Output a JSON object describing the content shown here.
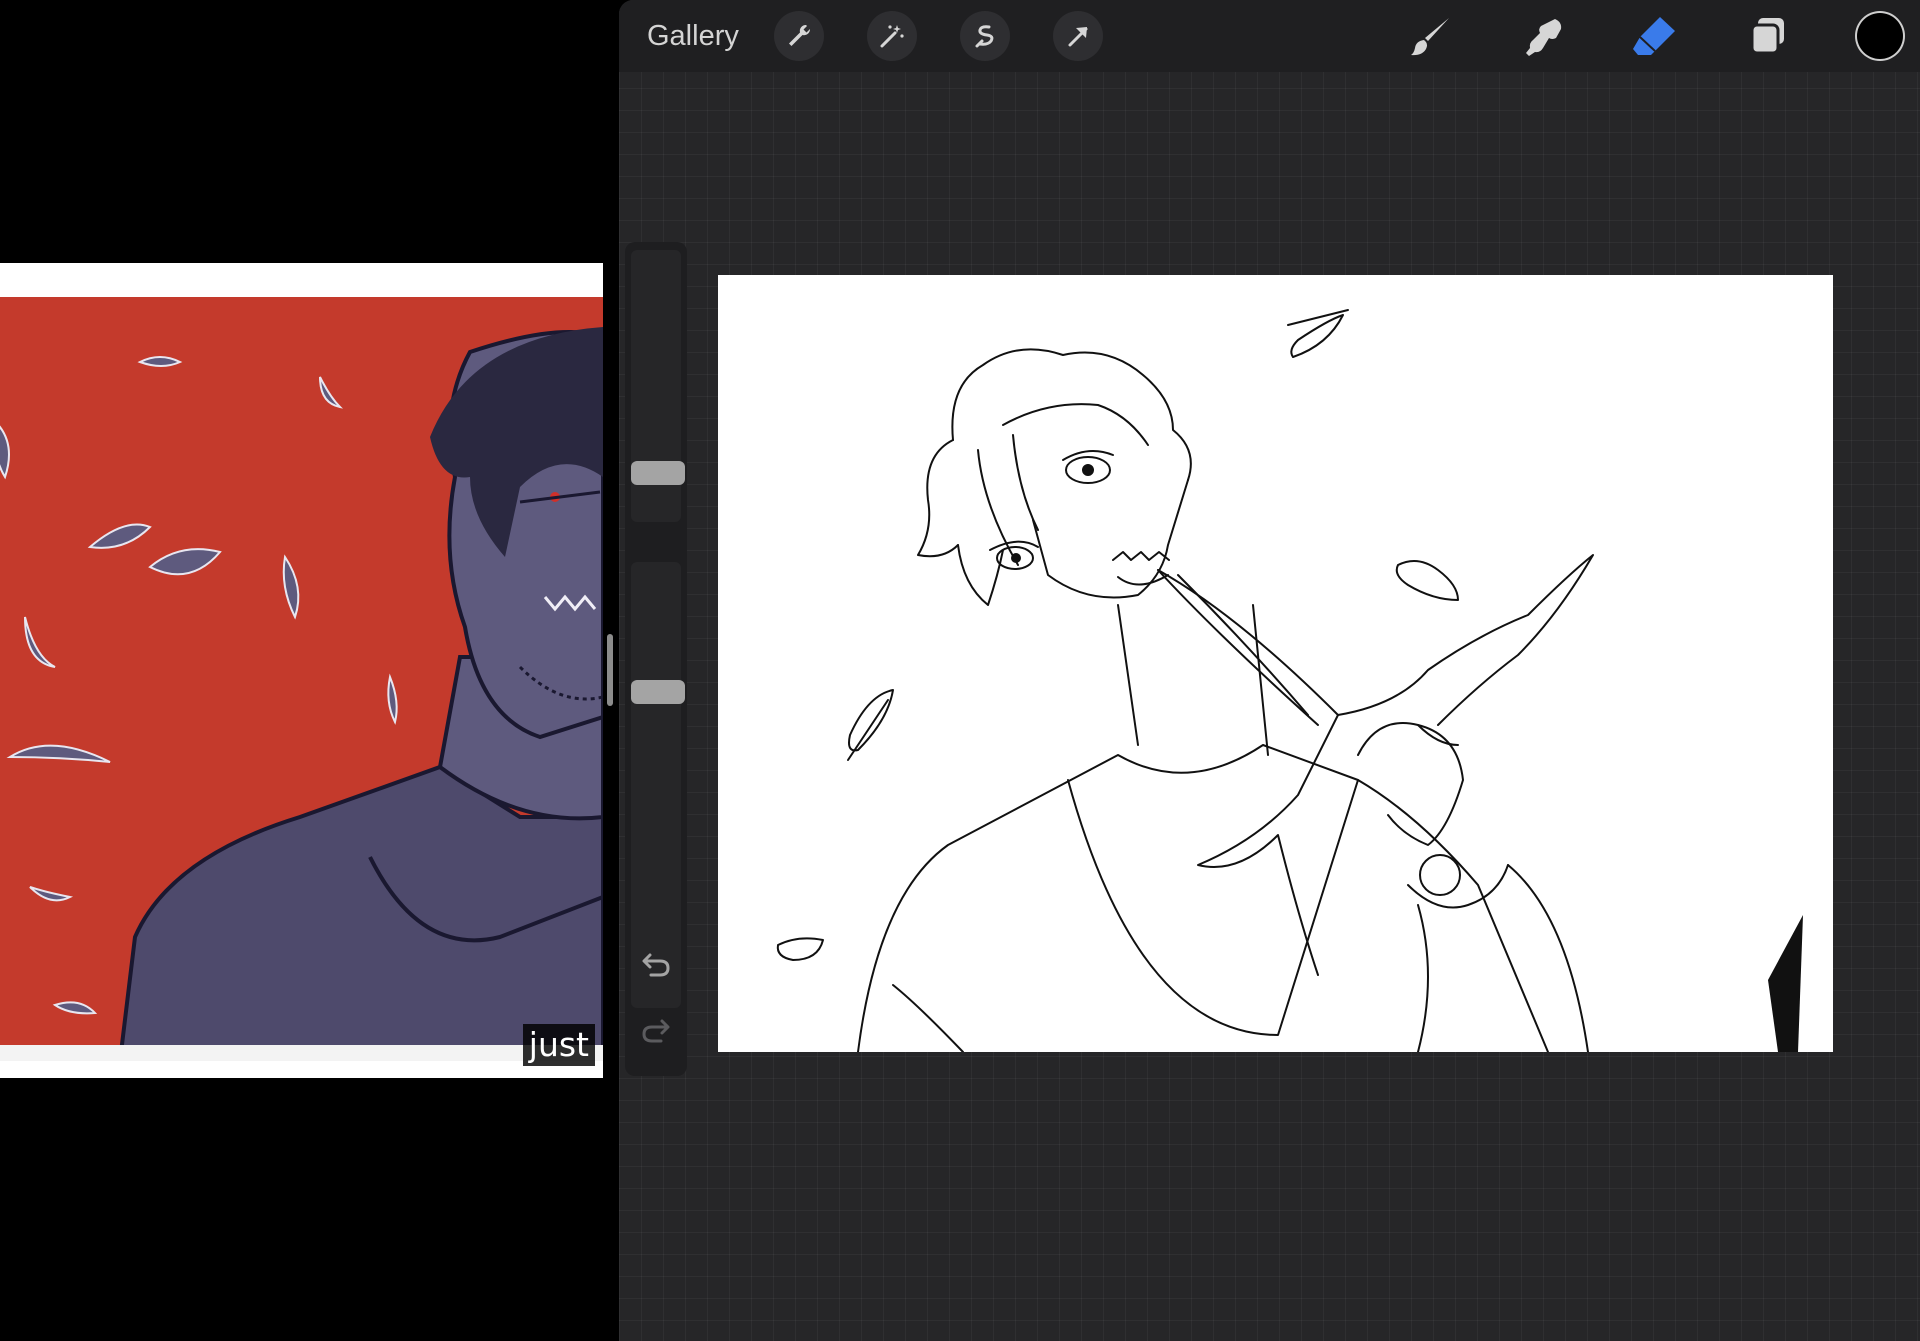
{
  "reference_video": {
    "caption": "just",
    "colors": {
      "background": "#c43a2c",
      "figure": "#5e5a7e",
      "outline": "#1a1830"
    }
  },
  "procreate": {
    "toolbar": {
      "gallery_label": "Gallery",
      "left_tools": [
        "wrench-icon",
        "magic-wand-icon",
        "selection-icon",
        "transform-arrow-icon"
      ],
      "right_tools": [
        "brush-icon",
        "smudge-icon",
        "eraser-icon",
        "layers-icon"
      ],
      "active_tool": "eraser",
      "accent_color": "#3a7bea",
      "current_color": "#000000"
    },
    "sidebar": {
      "brush_size_level": 0.15,
      "opacity_level": 0.72,
      "modify_button": "square-icon",
      "undo": "undo-icon",
      "redo": "redo-icon"
    },
    "canvas": {
      "background": "#ffffff",
      "subject": "line-art"
    }
  }
}
